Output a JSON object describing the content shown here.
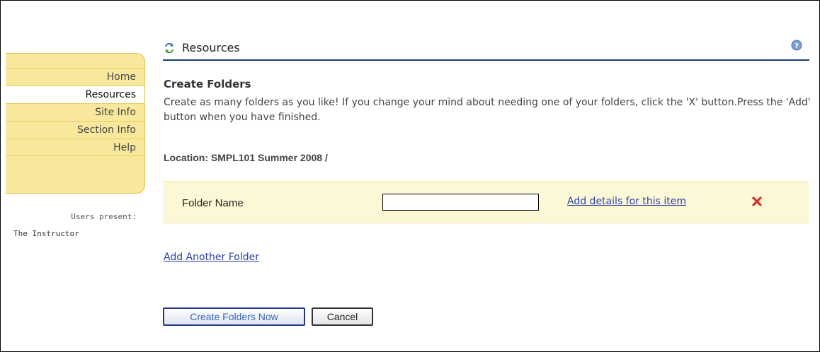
{
  "nav": {
    "items": [
      {
        "label": "Home",
        "active": false
      },
      {
        "label": "Resources",
        "active": true
      },
      {
        "label": "Site Info",
        "active": false
      },
      {
        "label": "Section Info",
        "active": false
      },
      {
        "label": "Help",
        "active": false
      }
    ],
    "users_present_label": "Users present:",
    "users": [
      "The Instructor"
    ]
  },
  "header": {
    "title": "Resources",
    "tool_icon": "refresh-arrows-icon",
    "help_icon": "help-icon"
  },
  "main": {
    "section_title": "Create Folders",
    "instructions": "Create as many folders as you like! If you change your mind about needing one of your folders, click the 'X' button.Press the 'Add' button when you have finished.",
    "location": "Location: SMPL101 Summer 2008 /",
    "folder_row": {
      "label": "Folder Name",
      "value": "",
      "placeholder": "",
      "details_link": "Add details for this item",
      "remove_icon": "red-x-icon"
    },
    "add_another_link": "Add Another Folder"
  },
  "buttons": {
    "create": "Create Folders Now",
    "cancel": "Cancel"
  },
  "colors": {
    "nav_bg": "#f8e89c",
    "title_rule": "#1b3c78",
    "link": "#2a3fa8",
    "row_bg": "#fcf8d6",
    "remove": "#d9302a"
  }
}
